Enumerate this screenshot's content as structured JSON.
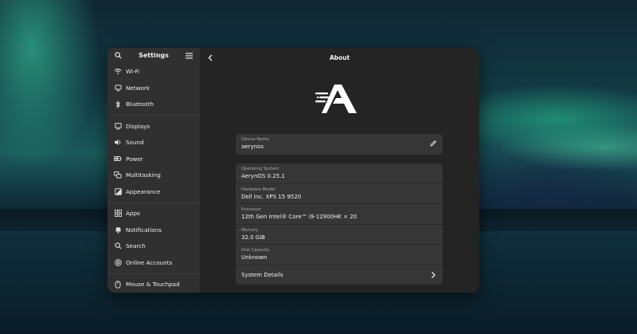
{
  "sidebar": {
    "title": "Settings",
    "items": [
      {
        "label": "Wi-Fi",
        "icon": "wifi-icon"
      },
      {
        "label": "Network",
        "icon": "network-icon"
      },
      {
        "label": "Bluetooth",
        "icon": "bluetooth-icon"
      },
      {
        "label": "Displays",
        "icon": "display-icon"
      },
      {
        "label": "Sound",
        "icon": "sound-icon"
      },
      {
        "label": "Power",
        "icon": "power-icon"
      },
      {
        "label": "Multitasking",
        "icon": "multitasking-icon"
      },
      {
        "label": "Appearance",
        "icon": "appearance-icon"
      },
      {
        "label": "Apps",
        "icon": "apps-icon"
      },
      {
        "label": "Notifications",
        "icon": "bell-icon"
      },
      {
        "label": "Search",
        "icon": "search-icon"
      },
      {
        "label": "Online Accounts",
        "icon": "at-icon"
      },
      {
        "label": "Mouse & Touchpad",
        "icon": "mouse-icon"
      }
    ]
  },
  "main": {
    "title": "About",
    "device": {
      "label": "Device Name",
      "value": "aerynos"
    },
    "info": [
      {
        "label": "Operating System",
        "value": "AerynOS 0.25.1"
      },
      {
        "label": "Hardware Model",
        "value": "Dell Inc. XPS 15 9520"
      },
      {
        "label": "Processor",
        "value": "12th Gen Intel® Core™ i9-12900HK × 20"
      },
      {
        "label": "Memory",
        "value": "32.0 GiB"
      },
      {
        "label": "Disk Capacity",
        "value": "Unknown"
      }
    ],
    "details_label": "System Details"
  },
  "colors": {
    "sidebar_bg": "#303030",
    "content_bg": "#242424",
    "card_bg": "#363636"
  }
}
